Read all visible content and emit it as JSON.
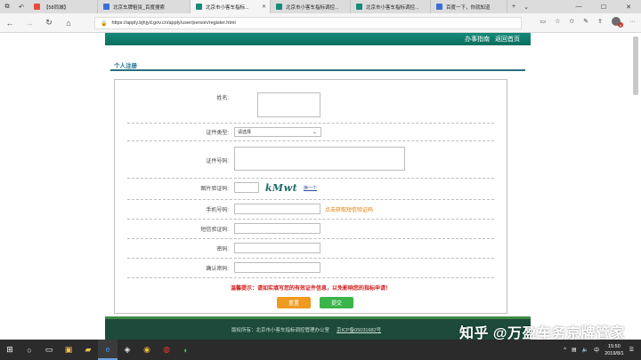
{
  "browser": {
    "tabs": [
      {
        "label": "【58同城】",
        "color": "#e94b3c"
      },
      {
        "label": "北京车牌租赁_百度搜索",
        "color": "#3a6fd8"
      },
      {
        "label": "北京市小客车指标...",
        "color": "#1a8a7a",
        "active": true
      },
      {
        "label": "北京市小客车指标调控...",
        "color": "#1a8a7a"
      },
      {
        "label": "北京市小客车指标调控...",
        "color": "#1a8a7a"
      },
      {
        "label": "百度一下，你就知道",
        "color": "#3a6fd8"
      }
    ],
    "url": "https://apply.bjhjyd.gov.cn/apply/user/person/register.html",
    "profile_badge": "6"
  },
  "site": {
    "header_links": [
      "办事指南",
      "返回首页"
    ],
    "section_title": "个人注册"
  },
  "form": {
    "name_label": "姓名:",
    "id_type_label": "证件类型:",
    "id_type_value": "请选择",
    "id_number_label": "证件号码:",
    "captcha_label": "图片验证码:",
    "captcha_text": "kMwt",
    "captcha_refresh": "换一个",
    "phone_label": "手机号码:",
    "sms_link": "点击获取短信验证码",
    "sms_code_label": "短信验证码:",
    "password_label": "密码:",
    "confirm_label": "确认密码:",
    "tip": "温馨提示：请如实填写您的有效证件信息，以免影响您的指标申请！",
    "reset_label": "重置",
    "submit_label": "提交"
  },
  "footer": {
    "copyright": "版权所有：北京市小客车指标调控管理办公室",
    "icp": "京ICP备05031682号"
  },
  "watermark": "知乎 @万盈车务京牌管家",
  "taskbar": {
    "time": "15:50",
    "date": "2019/8/1"
  },
  "colors": {
    "header": "#158a7a",
    "section_title": "#1a6c8c",
    "tip": "#d21a1a",
    "reset": "#f09a1f",
    "submit": "#3bb54a",
    "footer": "#1d4a3a"
  }
}
